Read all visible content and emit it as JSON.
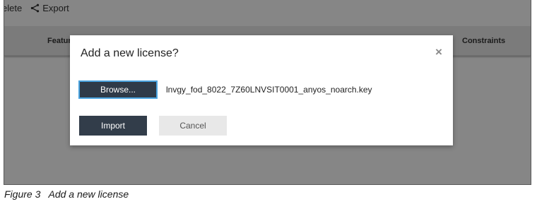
{
  "toolbar": {
    "delete_label": "elete",
    "export_label": "Export"
  },
  "table": {
    "columns": [
      "Featur",
      "Constraints"
    ]
  },
  "dialog": {
    "title": "Add a new license?",
    "close_glyph": "×",
    "browse_label": "Browse...",
    "selected_file": "lnvgy_fod_8022_7Z60LNVSIT0001_anyos_noarch.key",
    "import_label": "Import",
    "cancel_label": "Cancel"
  },
  "caption": "Figure 3   Add a new license",
  "colors": {
    "overlay": "#868686",
    "primary_button": "#323d4a",
    "focus_border": "#4aa3df",
    "secondary_button": "#e8e8e8"
  },
  "icons": {
    "export": "share-icon",
    "close": "close-icon"
  }
}
